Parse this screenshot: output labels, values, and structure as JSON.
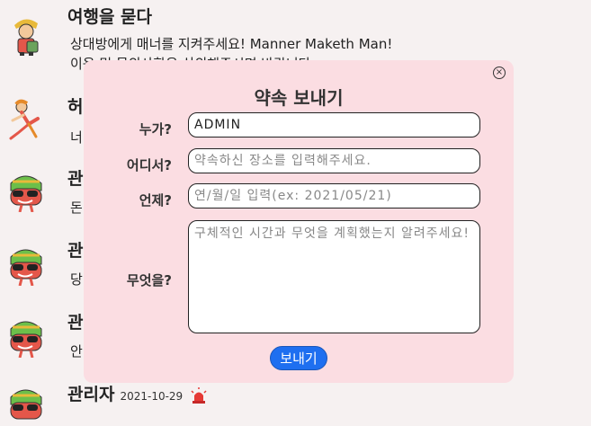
{
  "feed": {
    "post1": {
      "title": "여행을 묻다",
      "line1": "상대방에게 매너를 지켜주세요! Manner Maketh Man!",
      "line2": "이용 및 문의사항은 상의해주시면 바랍니다"
    },
    "post2": {
      "title": "허",
      "text": "너"
    },
    "post3": {
      "title": "관",
      "text": "돈"
    },
    "post4": {
      "title": "관",
      "text": "당"
    },
    "post5": {
      "title": "관",
      "text": "안"
    },
    "post6": {
      "title": "관리자",
      "date": "2021-10-29"
    }
  },
  "modal": {
    "title": "약속 보내기",
    "close_glyph": "×",
    "who_label": "누가?",
    "who_value": "ADMIN",
    "where_label": "어디서?",
    "where_placeholder": "약속하신 장소를 입력해주세요.",
    "when_label": "언제?",
    "when_placeholder": "연/월/일 입력(ex: 2021/05/21)",
    "what_label": "무엇을?",
    "what_placeholder": "구체적인 시간과 무엇을 계획했는지 알려주세요!",
    "send_label": "보내기"
  },
  "colors": {
    "modal_bg": "#fbdde2",
    "button": "#1e6ff0",
    "page_bg": "#f6f1f1"
  }
}
